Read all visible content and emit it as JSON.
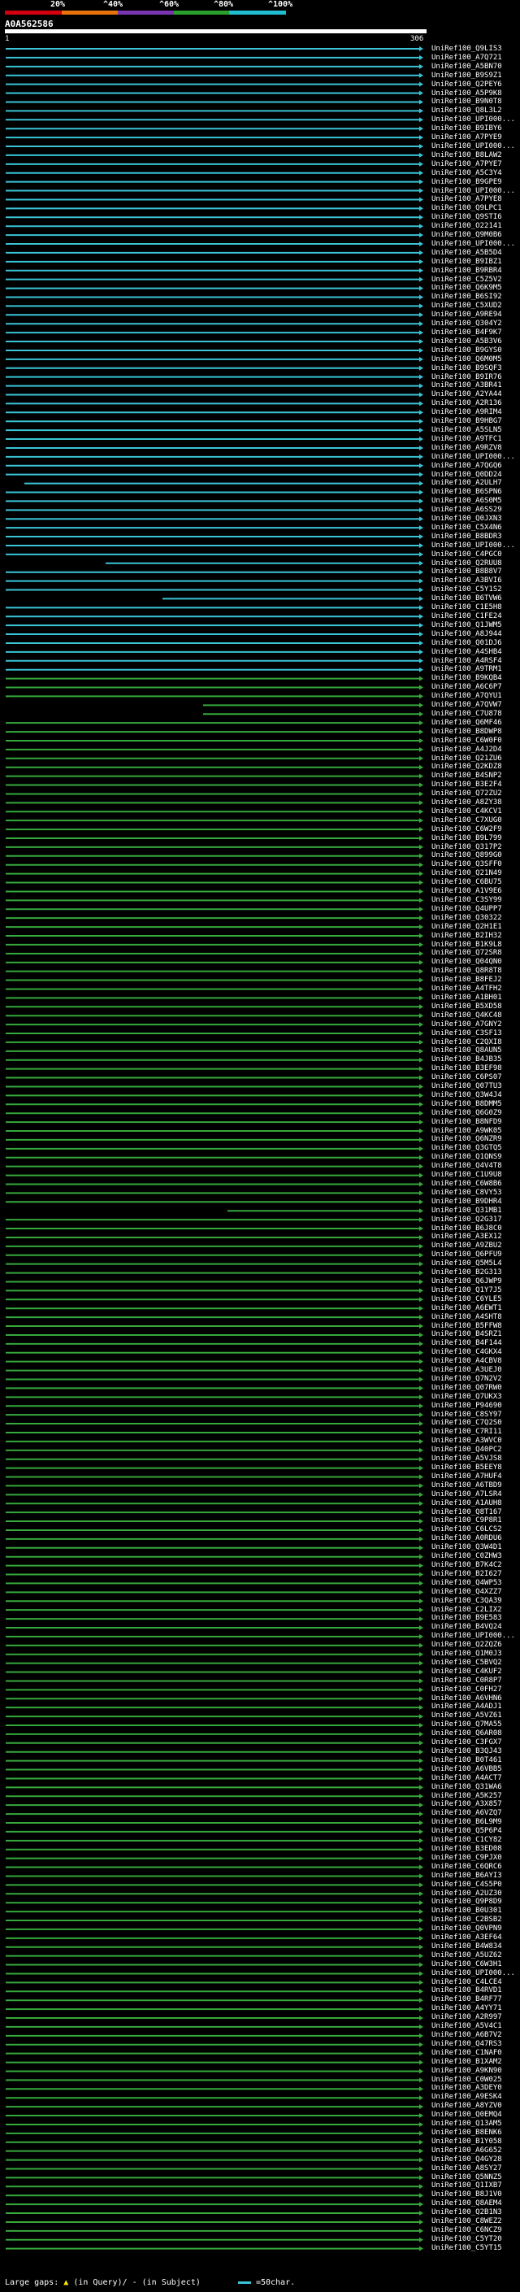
{
  "legend": {
    "labels": [
      "20%",
      "^40%",
      "^60%",
      "^80%",
      "^100%"
    ],
    "colors": [
      "#d4000f",
      "#e8730c",
      "#7a36b1",
      "#2ca02c",
      "#1fbfd1"
    ]
  },
  "query": {
    "id": "A0A562586",
    "ruler_start": "1",
    "ruler_end": "306"
  },
  "footer": {
    "gaps_label": "Large gaps:",
    "in_query": "(in Query)/",
    "in_subject": "- (in Subject)",
    "scale_label": "=50char."
  },
  "colors": {
    "cyan": "#3ac4d6",
    "green": "#36a83c",
    "yellow": "#ffe700"
  },
  "hits": [
    "UniRef100_Q9LIS3",
    "UniRef100_A7Q721",
    "UniRef100_A5BN70",
    "UniRef100_B9S9Z1",
    "UniRef100_Q2PEY6",
    "UniRef100_A5P9K8",
    "UniRef100_B9N0T8",
    "UniRef100_Q8L3L2",
    "UniRef100_UPI000...",
    "UniRef100_B9IBY6",
    "UniRef100_A7PYE9",
    "UniRef100_UPI000...",
    "UniRef100_B8LAW2",
    "UniRef100_A7PYE7",
    "UniRef100_A5C3Y4",
    "UniRef100_B9GPE9",
    "UniRef100_UPI000...",
    "UniRef100_A7PYE8",
    "UniRef100_Q9LPC1",
    "UniRef100_Q9STI6",
    "UniRef100_O22141",
    "UniRef100_Q9M0B6",
    "UniRef100_UPI000...",
    "UniRef100_A5B5D4",
    "UniRef100_B9IBZ1",
    "UniRef100_B9RBR4",
    "UniRef100_C5Z5V2",
    "UniRef100_Q6K9M5",
    "UniRef100_B6SI92",
    "UniRef100_C5XUD2",
    "UniRef100_A9RE94",
    "UniRef100_Q304Y2",
    "UniRef100_B4F9K7",
    "UniRef100_A5B3V6",
    "UniRef100_B9GYS0",
    "UniRef100_Q6M0M5",
    "UniRef100_B9SQF3",
    "UniRef100_B9IR76",
    "UniRef100_A3BR41",
    "UniRef100_A2YA44",
    "UniRef100_A2R136",
    "UniRef100_A9RIM4",
    "UniRef100_B9HBG7",
    "UniRef100_A5SLN5",
    "UniRef100_A9TFC1",
    "UniRef100_A9RZV8",
    "UniRef100_UPI000...",
    "UniRef100_A7QGQ6",
    "UniRef100_Q0DD24",
    "UniRef100_A2ULH7",
    "UniRef100_B6SPN6",
    "UniRef100_A6S0M5",
    "UniRef100_A6SS29",
    "UniRef100_Q0JXN3",
    "UniRef100_C5X4N6",
    "UniRef100_B8BDR3",
    "UniRef100_UPI000...",
    "UniRef100_C4PGC0",
    "UniRef100_Q2RUU8",
    "UniRef100_B8B8V7",
    "UniRef100_A3BVI6",
    "UniRef100_C5Y1S2",
    "UniRef100_B6TVW6",
    "UniRef100_C1E5H8",
    "UniRef100_C1FE24",
    "UniRef100_Q1JWM5",
    "UniRef100_A8J944",
    "UniRef100_Q01DJ6",
    "UniRef100_A4SHB4",
    "UniRef100_A4RSF4",
    "UniRef100_A9TRM1",
    "UniRef100_B9KQB4",
    "UniRef100_A6C6P7",
    "UniRef100_A7QYU1",
    "UniRef100_A7QVW7",
    "UniRef100_C7U878",
    "UniRef100_Q6MF46",
    "UniRef100_B8DWP8",
    "UniRef100_C6W0F0",
    "UniRef100_A4J2D4",
    "UniRef100_Q21ZU6",
    "UniRef100_Q2KDZ8",
    "UniRef100_B4SNP2",
    "UniRef100_B3E2F4",
    "UniRef100_Q72ZU2",
    "UniRef100_A8ZY38",
    "UniRef100_C4KCV1",
    "UniRef100_C7XUG0",
    "UniRef100_C6W2F9",
    "UniRef100_B9L799",
    "UniRef100_Q317P2",
    "UniRef100_Q899G0",
    "UniRef100_Q3SFF0",
    "UniRef100_Q21N49",
    "UniRef100_C6BU75",
    "UniRef100_A1V9E6",
    "UniRef100_C3SY99",
    "UniRef100_Q4UPP7",
    "UniRef100_Q30322",
    "UniRef100_Q2H1E1",
    "UniRef100_B2IH32",
    "UniRef100_B1K9L8",
    "UniRef100_Q72SR8",
    "UniRef100_Q04QN0",
    "UniRef100_Q8R8T8",
    "UniRef100_B8FEJ2",
    "UniRef100_A4TFH2",
    "UniRef100_A1BH01",
    "UniRef100_B5XD58",
    "UniRef100_Q4KC48",
    "UniRef100_A7GNY2",
    "UniRef100_C3SF13",
    "UniRef100_C2QXI8",
    "UniRef100_Q8AUN5",
    "UniRef100_B4JB35",
    "UniRef100_B3EF98",
    "UniRef100_C6PS07",
    "UniRef100_Q07TU3",
    "UniRef100_Q3W4J4",
    "UniRef100_B8DMM5",
    "UniRef100_Q6G0Z9",
    "UniRef100_B8NFD9",
    "UniRef100_A9WK05",
    "UniRef100_Q6NZR9",
    "UniRef100_Q3GTQ5",
    "UniRef100_Q1QNS9",
    "UniRef100_Q4V4T8",
    "UniRef100_C1U9U8",
    "UniRef100_C6W8B6",
    "UniRef100_C8VY53",
    "UniRef100_B9DHR4",
    "UniRef100_Q31MB1",
    "UniRef100_Q2G317",
    "UniRef100_B6J8C0",
    "UniRef100_A3EX12",
    "UniRef100_A9ZBU2",
    "UniRef100_Q6PFU9",
    "UniRef100_Q5M5L4",
    "UniRef100_B2G313",
    "UniRef100_Q6JWP9",
    "UniRef100_Q1Y7J5",
    "UniRef100_C6YLE5",
    "UniRef100_A6EWT1",
    "UniRef100_A4SHT8",
    "UniRef100_B5FFW8",
    "UniRef100_B4SRZ1",
    "UniRef100_B4F144",
    "UniRef100_C4GKX4",
    "UniRef100_A4CBV8",
    "UniRef100_A3UEJ0",
    "UniRef100_Q7N2V2",
    "UniRef100_Q07RW0",
    "UniRef100_Q7UKX3",
    "UniRef100_P94690",
    "UniRef100_C8SY97",
    "UniRef100_C7Q2S0",
    "UniRef100_C7RI11",
    "UniRef100_A3WVC0",
    "UniRef100_Q40PC2",
    "UniRef100_A5VJS8",
    "UniRef100_B5EEY8",
    "UniRef100_A7HUF4",
    "UniRef100_A6TBD9",
    "UniRef100_A7LSR4",
    "UniRef100_A1AUH8",
    "UniRef100_Q8T167",
    "UniRef100_C9P8R1",
    "UniRef100_C6LCS2",
    "UniRef100_A0RDU6",
    "UniRef100_Q3W4D1",
    "UniRef100_C0ZHW3",
    "UniRef100_B7K4C2",
    "UniRef100_B2I627",
    "UniRef100_Q4WP53",
    "UniRef100_Q4XZZ7",
    "UniRef100_C3QA39",
    "UniRef100_C2LIX2",
    "UniRef100_B9E583",
    "UniRef100_B4VQ24",
    "UniRef100_UPI000...",
    "UniRef100_Q2ZQZ6",
    "UniRef100_Q1M0J3",
    "UniRef100_C5BVQ2",
    "UniRef100_C4KUF2",
    "UniRef100_C0R8P7",
    "UniRef100_C0FH27",
    "UniRef100_A6VHN6",
    "UniRef100_A4ADJ1",
    "UniRef100_A5VZ61",
    "UniRef100_Q7MA55",
    "UniRef100_Q6AR08",
    "UniRef100_C3FGX7",
    "UniRef100_B3QJ43",
    "UniRef100_B0T461",
    "UniRef100_A6VBB5",
    "UniRef100_A4ACT7",
    "UniRef100_Q31WA6",
    "UniRef100_A5K257",
    "UniRef100_A3X857",
    "UniRef100_A6VZQ7",
    "UniRef100_B6L9M9",
    "UniRef100_Q5P6P4",
    "UniRef100_C1CY82",
    "UniRef100_B3ED08",
    "UniRef100_C9PJX0",
    "UniRef100_C6QRC6",
    "UniRef100_B6AYI3",
    "UniRef100_C4S5P0",
    "UniRef100_A2UZ30",
    "UniRef100_Q9P8D9",
    "UniRef100_B0U301",
    "UniRef100_C2BSB2",
    "UniRef100_Q0VPN9",
    "UniRef100_A3EF64",
    "UniRef100_B4W834",
    "UniRef100_A5UZ62",
    "UniRef100_C6W3H1",
    "UniRef100_UPI000...",
    "UniRef100_C4LCE4",
    "UniRef100_B4RVD1",
    "UniRef100_B4RF77",
    "UniRef100_A4YY71",
    "UniRef100_A2R997",
    "UniRef100_A5V4C1",
    "UniRef100_A6B7V2",
    "UniRef100_Q47RS3",
    "UniRef100_C1NAF0",
    "UniRef100_B1XAM2",
    "UniRef100_A9KN90",
    "UniRef100_C0W025",
    "UniRef100_A3DEY0",
    "UniRef100_A9ESK4",
    "UniRef100_A8YZV0",
    "UniRef100_Q0EMQ4",
    "UniRef100_Q13AM5",
    "UniRef100_B8ENK6",
    "UniRef100_B1Y058",
    "UniRef100_A6G652",
    "UniRef100_Q4GY28",
    "UniRef100_A8SY27",
    "UniRef100_Q5NNZ5",
    "UniRef100_Q1IXB7",
    "UniRef100_B8J1V0",
    "UniRef100_Q8AEM4",
    "UniRef100_Q2B1N3",
    "UniRef100_C8WEZ2",
    "UniRef100_C6NCZ9",
    "UniRef100_C5YT20",
    "UniRef100_C5YT15"
  ]
}
